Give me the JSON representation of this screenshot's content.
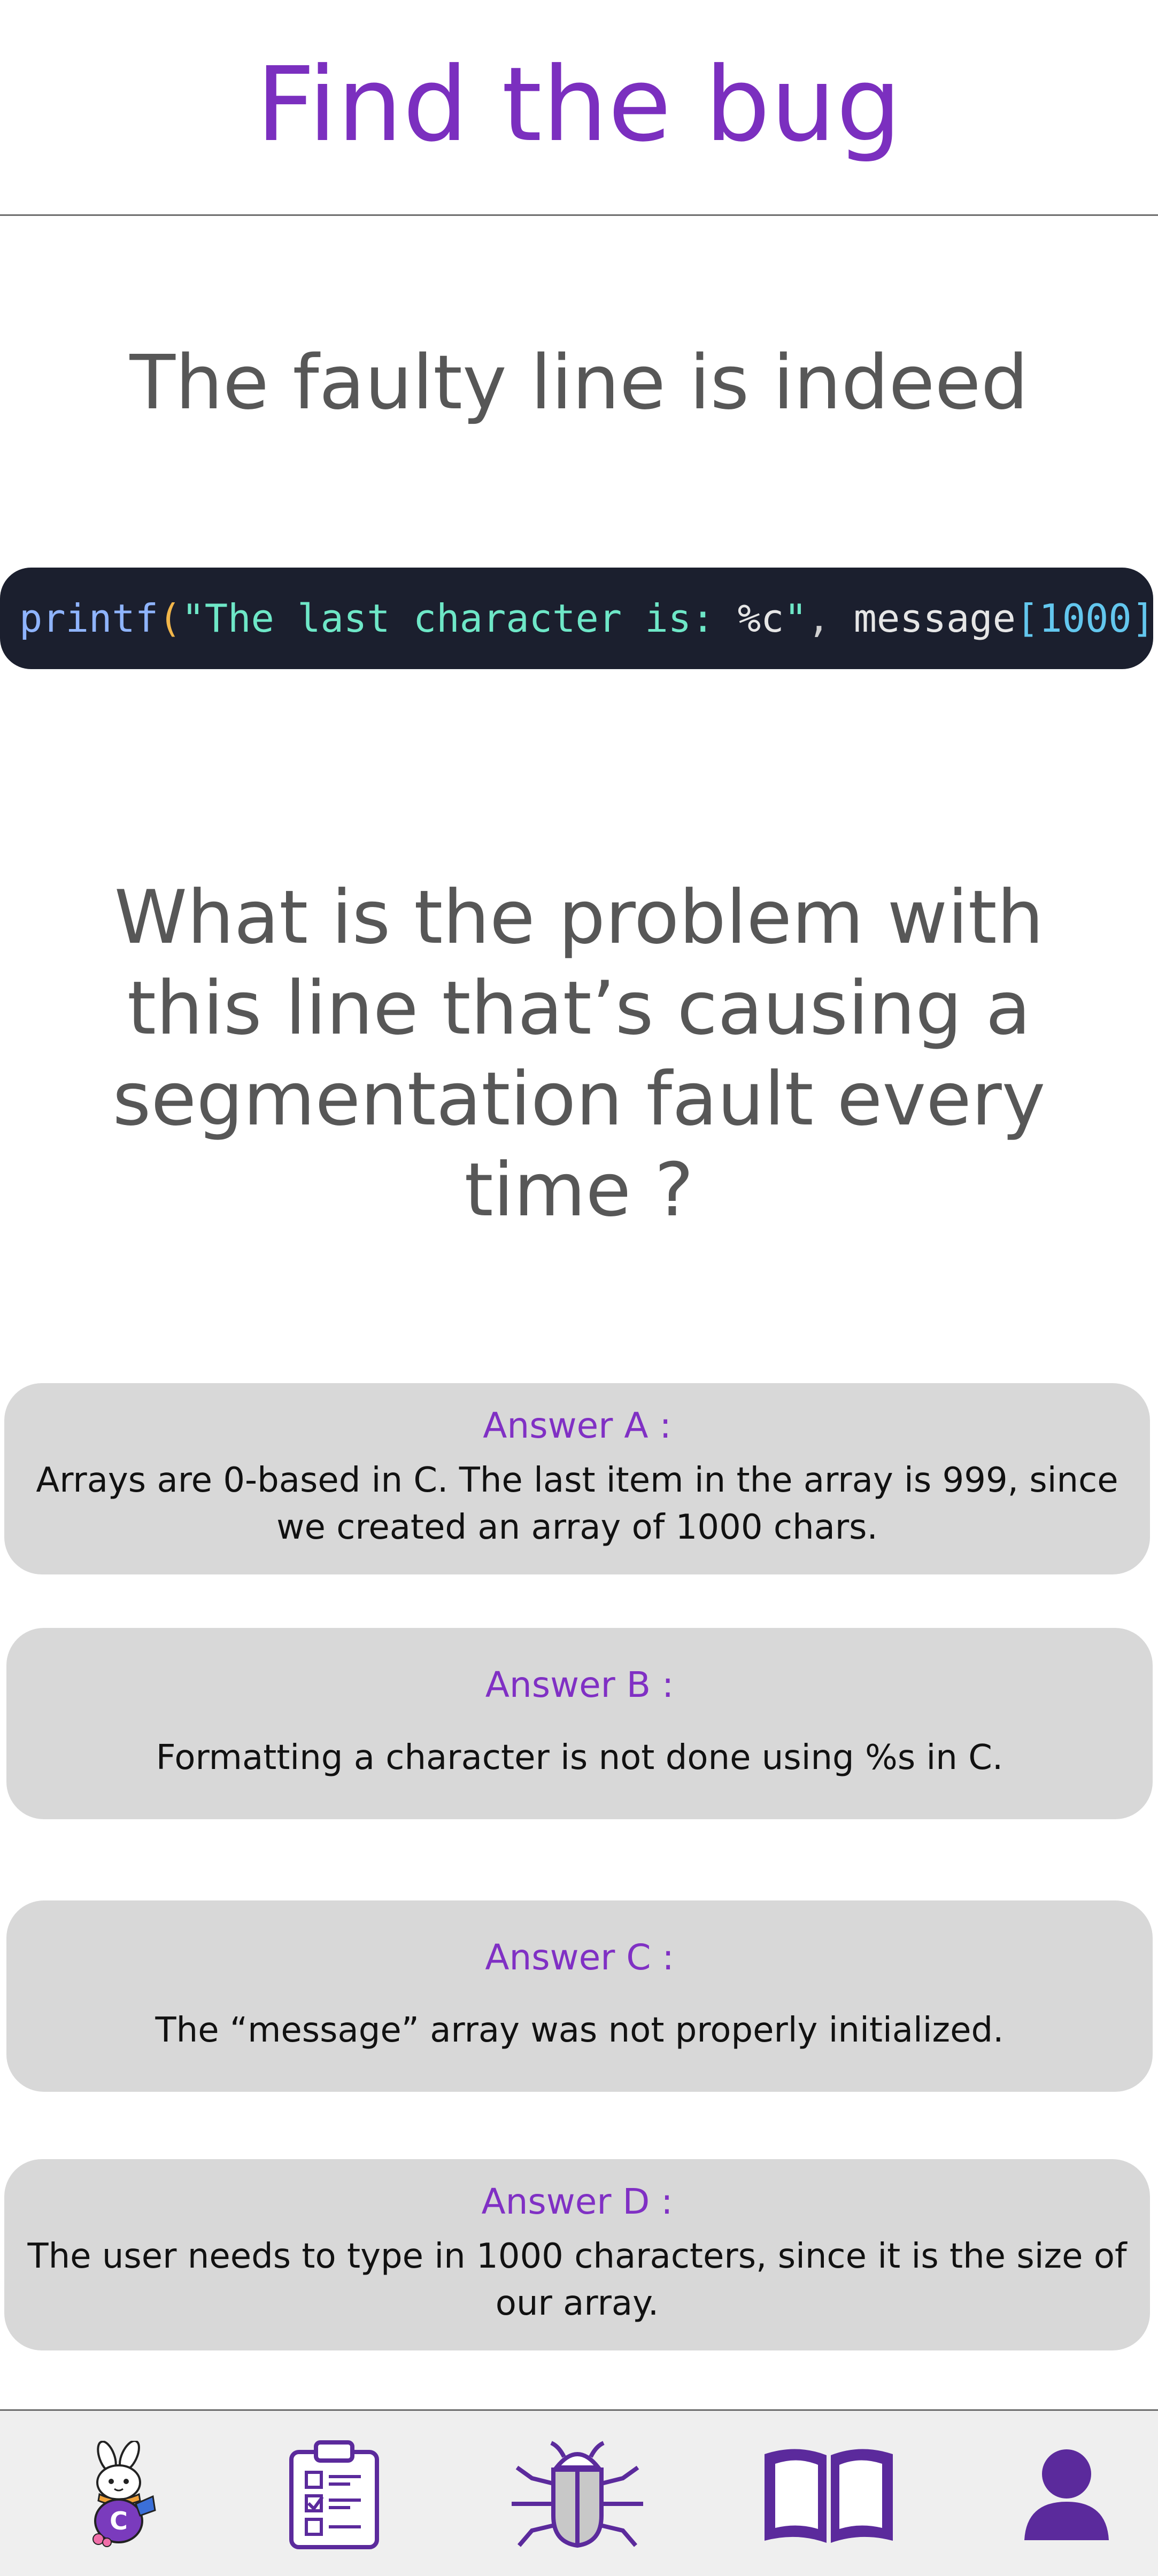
{
  "header": {
    "title": "Find the bug"
  },
  "subhead": {
    "text": "The faulty line is indeed"
  },
  "code": {
    "func": "printf",
    "open_paren": "(",
    "string_part": "\"The last character is: ",
    "format_spec": "%c",
    "string_close": "\"",
    "comma": ", ",
    "var": "message",
    "open_bracket": "[",
    "index": "1000",
    "close_bracket": "]",
    "close_paren": ")",
    "semicolon": ";"
  },
  "question": {
    "text": "What is the problem with this line that’s causing a segmentation fault every time ?"
  },
  "answers": [
    {
      "title": "Answer A :",
      "text": "Arrays are 0-based in C. The last item in the array is 999, since we created an array of 1000 chars."
    },
    {
      "title": "Answer B :",
      "text": "Formatting a character is not done using %s in C."
    },
    {
      "title": "Answer C :",
      "text": "The “message” array was not properly initialized."
    },
    {
      "title": "Answer D :",
      "text": "The user needs to type in 1000 characters, since it is the size of our array."
    }
  ],
  "nav": {
    "items": [
      {
        "icon": "mascot-icon"
      },
      {
        "icon": "clipboard-checklist-icon"
      },
      {
        "icon": "bug-icon"
      },
      {
        "icon": "book-icon"
      },
      {
        "icon": "user-icon"
      }
    ]
  },
  "colors": {
    "accent": "#7b2fbf",
    "code_bg": "#1b1f2e",
    "card_bg": "#d8d8d8",
    "nav_bg": "#efefef",
    "icon_purple": "#5b2a9c"
  }
}
